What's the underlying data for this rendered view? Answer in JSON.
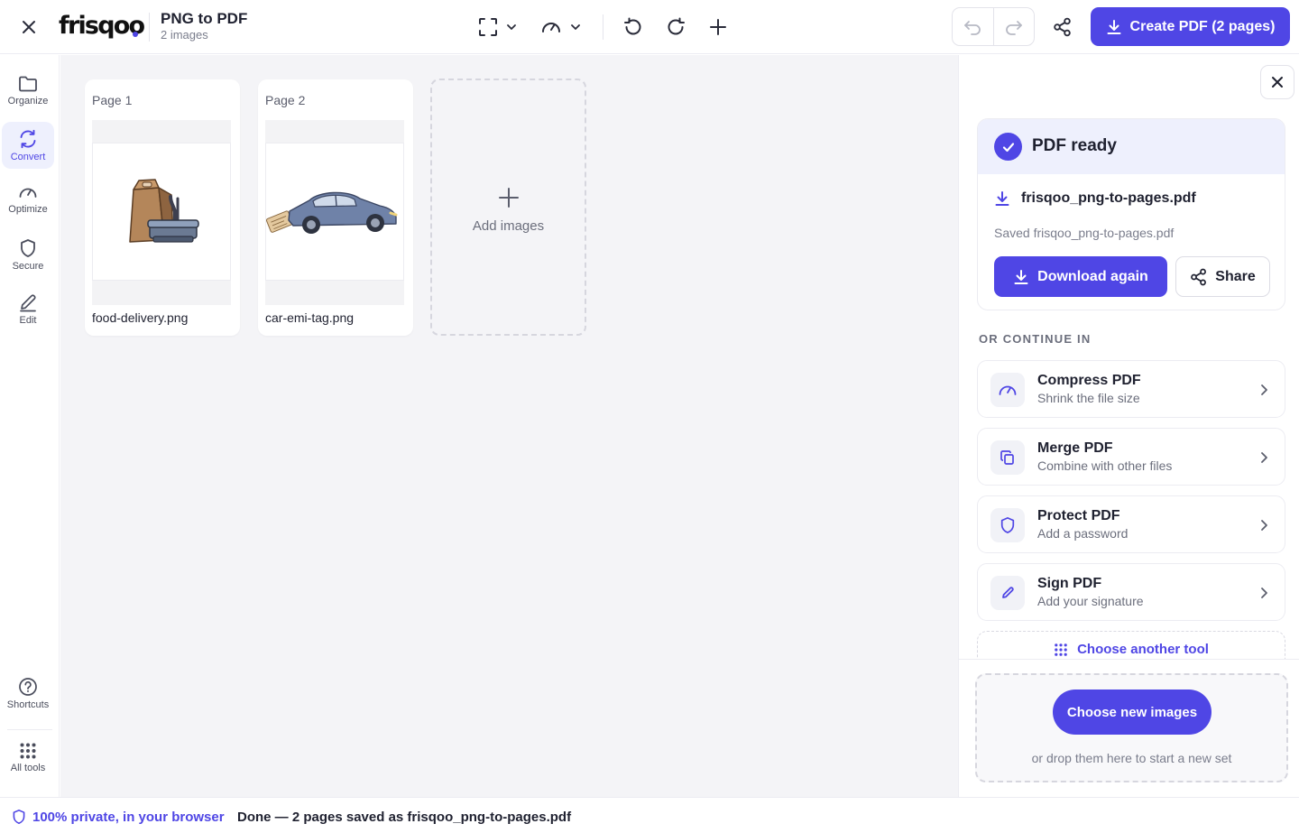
{
  "header": {
    "logo_text": "frisqoo",
    "title": "PNG to PDF",
    "subtitle": "2 images",
    "create_button_label": "Create PDF (2 pages)",
    "toolbar_icons": [
      "fit-icon",
      "chevron-down-icon",
      "gauge-icon",
      "chevron-down-icon",
      "rotate-left-icon",
      "rotate-right-icon",
      "plus-icon",
      "undo-icon",
      "redo-icon",
      "share-icon"
    ]
  },
  "sidebar": {
    "items": [
      {
        "label": "Organize",
        "icon": "folder-icon"
      },
      {
        "label": "Convert",
        "icon": "convert-icon",
        "active": true
      },
      {
        "label": "Optimize",
        "icon": "gauge-icon"
      },
      {
        "label": "Secure",
        "icon": "shield-icon"
      },
      {
        "label": "Edit",
        "icon": "pen-icon"
      }
    ],
    "bottom_items": [
      {
        "label": "Shortcuts",
        "icon": "help-icon"
      },
      {
        "label": "All tools",
        "icon": "grid-icon"
      }
    ]
  },
  "pages": [
    {
      "label": "Page 1",
      "file": "food-delivery.png",
      "thumb_icon": "food-delivery-image"
    },
    {
      "label": "Page 2",
      "file": "car-emi-tag.png",
      "thumb_icon": "car-image"
    }
  ],
  "add_card": {
    "label": "Add images"
  },
  "panel": {
    "ready_title": "PDF ready",
    "file_name": "frisqoo_png-to-pages.pdf",
    "saved_text": "Saved frisqoo_png-to-pages.pdf",
    "download_label": "Download again",
    "share_label": "Share",
    "continue_heading": "OR CONTINUE IN",
    "tools": [
      {
        "title": "Compress PDF",
        "subtitle": "Shrink the file size",
        "icon": "gauge-icon"
      },
      {
        "title": "Merge PDF",
        "subtitle": "Combine with other files",
        "icon": "copy-icon"
      },
      {
        "title": "Protect PDF",
        "subtitle": "Add a password",
        "icon": "shield-icon"
      },
      {
        "title": "Sign PDF",
        "subtitle": "Add your signature",
        "icon": "pen-icon"
      }
    ],
    "another_tool_label": "Choose another tool",
    "choose_images_label": "Choose new images",
    "drop_text": "or drop them here to start a new set"
  },
  "footer": {
    "privacy_text": "100% private, in your browser",
    "status_text": "Done — 2 pages saved as frisqoo_png-to-pages.pdf"
  },
  "colors": {
    "accent": "#4f46e5",
    "canvas_bg": "#f4f4f7",
    "accent_soft": "#eef0fd"
  }
}
